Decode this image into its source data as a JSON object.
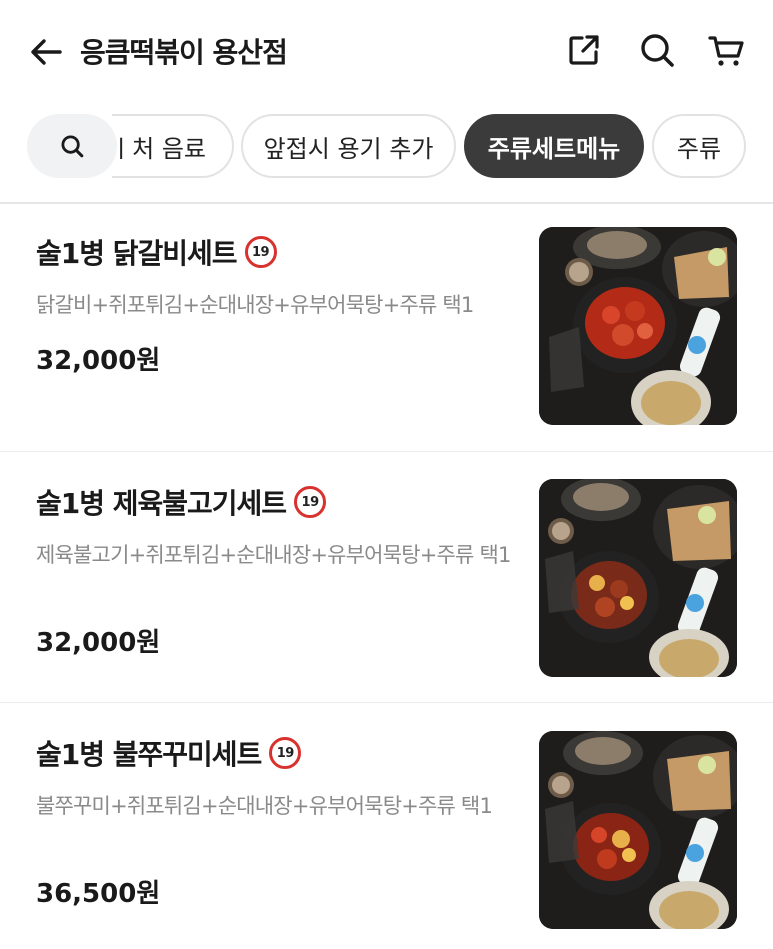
{
  "header": {
    "title": "응큼떡볶이 용산점",
    "icons": [
      "back-arrow-icon",
      "share-icon",
      "search-icon",
      "cart-icon"
    ]
  },
  "categories": {
    "items": [
      {
        "label": "ㅣ처 음료",
        "active": false
      },
      {
        "label": "앞접시 용기 추가",
        "active": false
      },
      {
        "label": "주류세트메뉴",
        "active": true
      },
      {
        "label": "주류",
        "active": false
      }
    ]
  },
  "menu": [
    {
      "name": "술1병 닭갈비세트",
      "badge": "19",
      "desc": "닭갈비+쥐포튀김+순대내장+유부어묵탕+주류 택1",
      "price": "32,000원"
    },
    {
      "name": "술1병 제육불고기세트",
      "badge": "19",
      "desc": "제육불고기+쥐포튀김+순대내장+유부어묵탕+주류 택1",
      "price": "32,000원"
    },
    {
      "name": "술1병 불쭈꾸미세트",
      "badge": "19",
      "desc": "불쭈꾸미+쥐포튀김+순대내장+유부어묵탕+주류 택1",
      "price": "36,500원"
    }
  ],
  "colors": {
    "active_chip": "#3b3b3b",
    "badge_ring": "#d8322f",
    "desc_text": "#8a8a8a"
  }
}
